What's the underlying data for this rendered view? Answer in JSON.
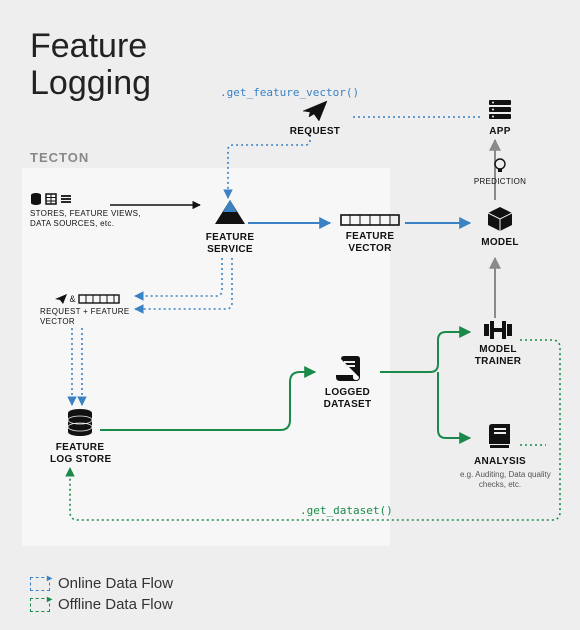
{
  "title_line1": "Feature",
  "title_line2": "Logging",
  "tecton_label": "TECTON",
  "nodes": {
    "request": {
      "label": "REQUEST"
    },
    "app": {
      "label": "APP"
    },
    "prediction": {
      "label": "PREDICTION"
    },
    "sources": {
      "label": "STORES, FEATURE VIEWS,\nDATA SOURCES, etc."
    },
    "feature_service": {
      "label": "FEATURE\nSERVICE"
    },
    "feature_vector": {
      "label": "FEATURE\nVECTOR"
    },
    "model": {
      "label": "MODEL"
    },
    "req_fv": {
      "label": "REQUEST + FEATURE\nVECTOR"
    },
    "logged_dataset": {
      "label": "LOGGED\nDATASET"
    },
    "model_trainer": {
      "label": "MODEL\nTRAINER"
    },
    "feature_log_store": {
      "label": "FEATURE\nLOG STORE"
    },
    "analysis": {
      "label": "ANALYSIS",
      "sub": "e.g. Auditing, Data quality\nchecks, etc."
    }
  },
  "annotations": {
    "get_feature_vector": ".get_feature_vector()",
    "get_dataset": ".get_dataset()"
  },
  "legend": {
    "online": "Online Data Flow",
    "offline": "Offline Data Flow"
  },
  "colors": {
    "blue": "#3a82c4",
    "green": "#1a8a4a",
    "gray": "#8a8a8a",
    "black": "#111"
  }
}
